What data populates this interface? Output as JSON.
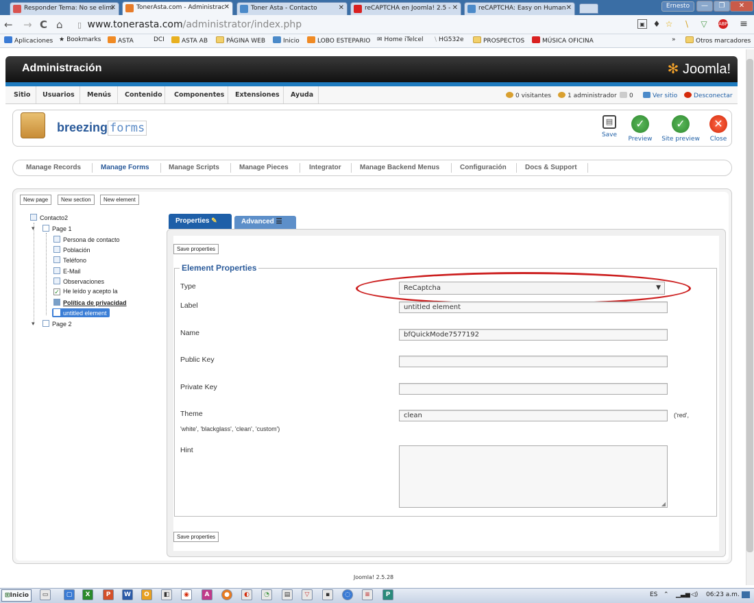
{
  "browser": {
    "tabs": [
      {
        "title": "Responder Tema: No se elimi",
        "color": "#d9534f"
      },
      {
        "title": "TonerAsta.com - Administrac",
        "color": "#e77c2a"
      },
      {
        "title": "Toner Asta - Contacto",
        "color": "#4b8ac9"
      },
      {
        "title": "reCAPTCHA en Joomla! 2.5 -",
        "color": "#d92020"
      },
      {
        "title": "reCAPTCHA: Easy on Human",
        "color": "#4b8ac9"
      }
    ],
    "user": "Ernesto",
    "url_host": "www.tonerasta.com",
    "url_path": "/administrator/index.php",
    "bookmarks": [
      "Aplicaciones",
      "Bookmarks",
      "ASTA",
      "DCI",
      "ASTA AB",
      "PÁGINA WEB",
      "Inicio",
      "LOBO ESTEPARIO",
      "Home iTelcel",
      "HG532e",
      "PROSPECTOS",
      "MÚSICA OFICINA"
    ],
    "other_bookmarks": "Otros marcadores"
  },
  "admin": {
    "title": "Administración",
    "logo_text": "Joomla!",
    "menu": [
      "Sitio",
      "Usuarios",
      "Menús",
      "Contenido",
      "Componentes",
      "Extensiones",
      "Ayuda"
    ],
    "status": {
      "visitors": "0 visitantes",
      "admins": "1 administrador",
      "messages": "0",
      "view_site": "Ver sitio",
      "logout": "Desconectar"
    }
  },
  "component": {
    "logo_bold": "breezing",
    "logo_rest": "forms",
    "toolbar": {
      "save": "Save",
      "preview": "Preview",
      "site_preview": "Site preview",
      "close": "Close"
    },
    "subtabs": [
      "Manage Records",
      "Manage Forms",
      "Manage Scripts",
      "Manage Pieces",
      "Integrator",
      "Manage Backend Menus",
      "Configuración",
      "Docs & Support"
    ]
  },
  "editor": {
    "buttons": {
      "new_page": "New page",
      "new_section": "New section",
      "new_element": "New element"
    },
    "tree": {
      "root": "Contacto2",
      "page1": "Page 1",
      "items": [
        "Persona de contacto",
        "Población",
        "Teléfono",
        "E-Mail",
        "Observaciones",
        "He leído y acepto la",
        "Política de privacidad",
        "untitled element"
      ],
      "page2": "Page 2"
    },
    "tabs": {
      "properties": "Properties",
      "advanced": "Advanced"
    },
    "save_properties": "Save properties",
    "section_title": "Element Properties",
    "fields": {
      "type_label": "Type",
      "type_value": "ReCaptcha",
      "label_label": "Label",
      "label_value": "untitled element",
      "name_label": "Name",
      "name_value": "bfQuickMode7577192",
      "public_key_label": "Public Key",
      "public_key_value": "",
      "private_key_label": "Private Key",
      "private_key_value": "",
      "theme_label": "Theme",
      "theme_value": "clean",
      "theme_hint_a": "('red',",
      "theme_hint_b": "'white', 'blackglass', 'clean', 'custom')",
      "hint_label": "Hint"
    }
  },
  "footer": "Joomla! 2.5.28",
  "taskbar": {
    "start": "Inicio",
    "lang": "ES",
    "time": "06:23 a.m."
  }
}
